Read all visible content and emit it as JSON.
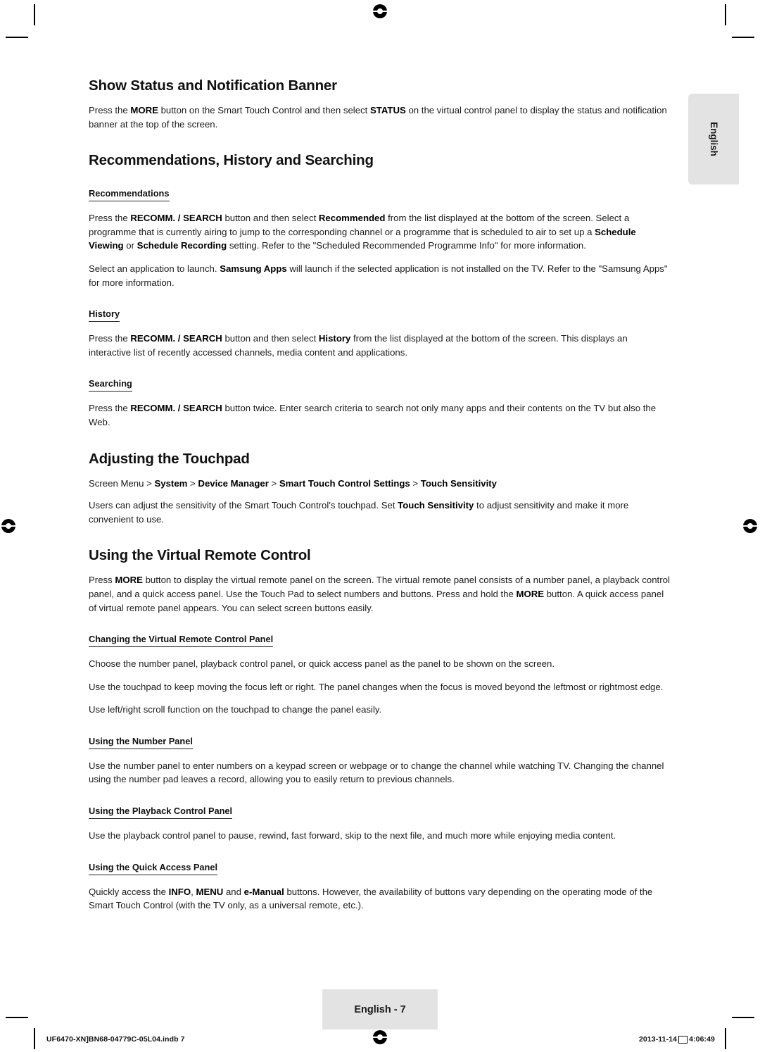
{
  "page": {
    "language_tab": "English",
    "page_marker": "English - 7",
    "footer_left": "UF6470-XN]BN68-04779C-05L04.indb   7",
    "footer_right_date": "2013-11-14",
    "footer_right_time": "4:06:49"
  },
  "sections": [
    {
      "id": "show-status",
      "heading": "Show Status and Notification Banner",
      "paragraphs": [
        {
          "runs": [
            {
              "t": "Press the ",
              "b": false
            },
            {
              "t": "MORE",
              "b": true
            },
            {
              "t": " button on the Smart Touch Control and then select ",
              "b": false
            },
            {
              "t": "STATUS",
              "b": true
            },
            {
              "t": " on the virtual control panel to display the status and notification banner at the top of the screen.",
              "b": false
            }
          ]
        }
      ]
    },
    {
      "id": "recommendations-history-searching",
      "heading": "Recommendations, History and Searching",
      "subsections": [
        {
          "id": "recommendations",
          "title": "Recommendations",
          "paragraphs": [
            {
              "runs": [
                {
                  "t": "Press the ",
                  "b": false
                },
                {
                  "t": "RECOMM. / SEARCH",
                  "b": true
                },
                {
                  "t": " button and then select ",
                  "b": false
                },
                {
                  "t": "Recommended",
                  "b": true
                },
                {
                  "t": " from the list displayed at the bottom of the screen. Select a programme that is currently airing to jump to the corresponding channel or a programme that is scheduled to air to set up a ",
                  "b": false
                },
                {
                  "t": "Schedule Viewing",
                  "b": true
                },
                {
                  "t": " or ",
                  "b": false
                },
                {
                  "t": "Schedule Recording",
                  "b": true
                },
                {
                  "t": " setting. Refer to the \"Scheduled Recommended Programme Info\" for more information.",
                  "b": false
                }
              ]
            },
            {
              "runs": [
                {
                  "t": "Select an application to launch. ",
                  "b": false
                },
                {
                  "t": "Samsung Apps",
                  "b": true
                },
                {
                  "t": " will launch if the selected application is not installed on the TV. Refer to the \"Samsung Apps\" for more information.",
                  "b": false
                }
              ]
            }
          ]
        },
        {
          "id": "history",
          "title": "History",
          "paragraphs": [
            {
              "runs": [
                {
                  "t": "Press the ",
                  "b": false
                },
                {
                  "t": "RECOMM. / SEARCH",
                  "b": true
                },
                {
                  "t": " button and then select ",
                  "b": false
                },
                {
                  "t": "History",
                  "b": true
                },
                {
                  "t": " from the list displayed at the bottom of the screen. This displays an interactive list of recently accessed channels, media content and applications.",
                  "b": false
                }
              ]
            }
          ]
        },
        {
          "id": "searching",
          "title": "Searching",
          "paragraphs": [
            {
              "runs": [
                {
                  "t": "Press the ",
                  "b": false
                },
                {
                  "t": "RECOMM. / SEARCH",
                  "b": true
                },
                {
                  "t": " button twice. Enter search criteria to search not only many apps and their contents on the TV but also the Web.",
                  "b": false
                }
              ]
            }
          ]
        }
      ]
    },
    {
      "id": "adjusting-touchpad",
      "heading": "Adjusting the Touchpad",
      "path": {
        "runs": [
          {
            "t": "Screen Menu > ",
            "b": false
          },
          {
            "t": "System",
            "b": true
          },
          {
            "t": " > ",
            "b": false
          },
          {
            "t": "Device Manager",
            "b": true
          },
          {
            "t": " > ",
            "b": false
          },
          {
            "t": "Smart Touch Control Settings",
            "b": true
          },
          {
            "t": " > ",
            "b": false
          },
          {
            "t": "Touch Sensitivity",
            "b": true
          }
        ]
      },
      "paragraphs": [
        {
          "runs": [
            {
              "t": "Users can adjust the sensitivity of the Smart Touch Control's touchpad. Set ",
              "b": false
            },
            {
              "t": "Touch Sensitivity",
              "b": true
            },
            {
              "t": " to adjust sensitivity and make it more convenient to use.",
              "b": false
            }
          ]
        }
      ]
    },
    {
      "id": "using-virtual-remote",
      "heading": "Using the Virtual Remote Control",
      "paragraphs": [
        {
          "runs": [
            {
              "t": "Press ",
              "b": false
            },
            {
              "t": "MORE",
              "b": true
            },
            {
              "t": " button to display the virtual remote panel on the screen. The virtual remote panel consists of a number panel, a playback control panel, and a quick access panel. Use the Touch Pad to select numbers and buttons. Press and hold the ",
              "b": false
            },
            {
              "t": "MORE",
              "b": true
            },
            {
              "t": " button. A quick access panel of virtual remote panel appears. You can select screen buttons easily.",
              "b": false
            }
          ]
        }
      ],
      "subsections": [
        {
          "id": "changing-panel",
          "title": "Changing the Virtual Remote Control Panel",
          "paragraphs": [
            {
              "runs": [
                {
                  "t": "Choose the number panel, playback control panel, or quick access panel as the panel to be shown on the screen.",
                  "b": false
                }
              ]
            },
            {
              "runs": [
                {
                  "t": "Use the touchpad to keep moving the focus left or right. The panel changes when the focus is moved beyond the leftmost or rightmost edge.",
                  "b": false
                }
              ]
            },
            {
              "runs": [
                {
                  "t": "Use left/right scroll function on the touchpad to change the panel easily.",
                  "b": false
                }
              ]
            }
          ]
        },
        {
          "id": "using-number-panel",
          "title": "Using the Number Panel",
          "paragraphs": [
            {
              "runs": [
                {
                  "t": "Use the number panel to enter numbers on a keypad screen or webpage or to change the channel while watching TV. Changing the channel using the number pad leaves a record, allowing you to easily return to previous channels.",
                  "b": false
                }
              ]
            }
          ]
        },
        {
          "id": "using-playback-panel",
          "title": "Using the Playback Control Panel",
          "paragraphs": [
            {
              "runs": [
                {
                  "t": "Use the playback control panel to pause, rewind, fast forward, skip to the next file, and much more while enjoying media content.",
                  "b": false
                }
              ]
            }
          ]
        },
        {
          "id": "using-quick-access-panel",
          "title": "Using the Quick Access Panel",
          "paragraphs": [
            {
              "runs": [
                {
                  "t": "Quickly access the ",
                  "b": false
                },
                {
                  "t": "INFO",
                  "b": true
                },
                {
                  "t": ", ",
                  "b": false
                },
                {
                  "t": "MENU",
                  "b": true
                },
                {
                  "t": " and ",
                  "b": false
                },
                {
                  "t": "e-Manual",
                  "b": true
                },
                {
                  "t": " buttons. However, the availability of buttons vary depending on the operating mode of the Smart Touch Control (with the TV only, as a universal remote, etc.).",
                  "b": false
                }
              ]
            }
          ]
        }
      ]
    }
  ]
}
